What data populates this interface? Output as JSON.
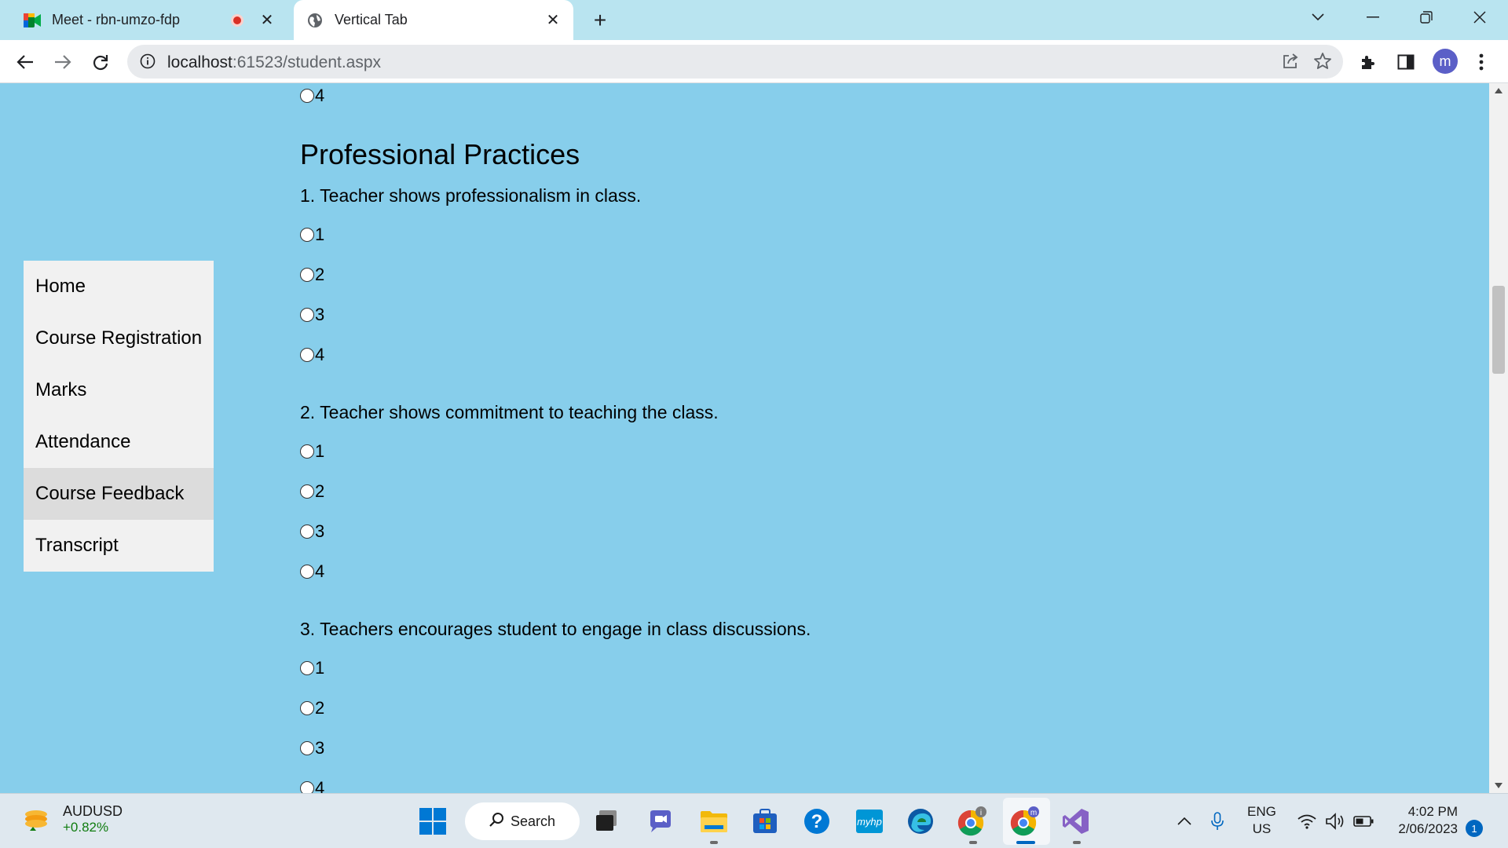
{
  "browser": {
    "tabs": [
      {
        "title": "Meet - rbn-umzo-fdp",
        "icon": "google-meet-icon",
        "recording": true
      },
      {
        "title": "Vertical Tab",
        "icon": "globe-icon",
        "active": true
      }
    ],
    "address": {
      "host": "localhost",
      "path": ":61523/student.aspx"
    },
    "profile_initial": "m"
  },
  "sidebar": {
    "items": [
      {
        "label": "Home"
      },
      {
        "label": "Course Registration"
      },
      {
        "label": "Marks"
      },
      {
        "label": "Attendance"
      },
      {
        "label": "Course Feedback",
        "active": true
      },
      {
        "label": "Transcript"
      }
    ]
  },
  "form": {
    "prev_option": "4",
    "section_title": "Professional Practices",
    "questions": [
      {
        "text": "1. Teacher shows professionalism in class.",
        "options": [
          "1",
          "2",
          "3",
          "4"
        ]
      },
      {
        "text": "2. Teacher shows commitment to teaching the class.",
        "options": [
          "1",
          "2",
          "3",
          "4"
        ]
      },
      {
        "text": "3. Teachers encourages student to engage in class discussions.",
        "options": [
          "1",
          "2",
          "3",
          "4"
        ]
      }
    ]
  },
  "taskbar": {
    "ticker_symbol": "AUDUSD",
    "ticker_change": "+0.82%",
    "search_label": "Search",
    "lang_line1": "ENG",
    "lang_line2": "US",
    "time": "4:02 PM",
    "date": "2/06/2023",
    "notification_count": "1"
  },
  "colors": {
    "page_background": "#87ceeb",
    "sidebar_background": "#f1f1f1",
    "sidebar_active": "#dcdcdc"
  }
}
